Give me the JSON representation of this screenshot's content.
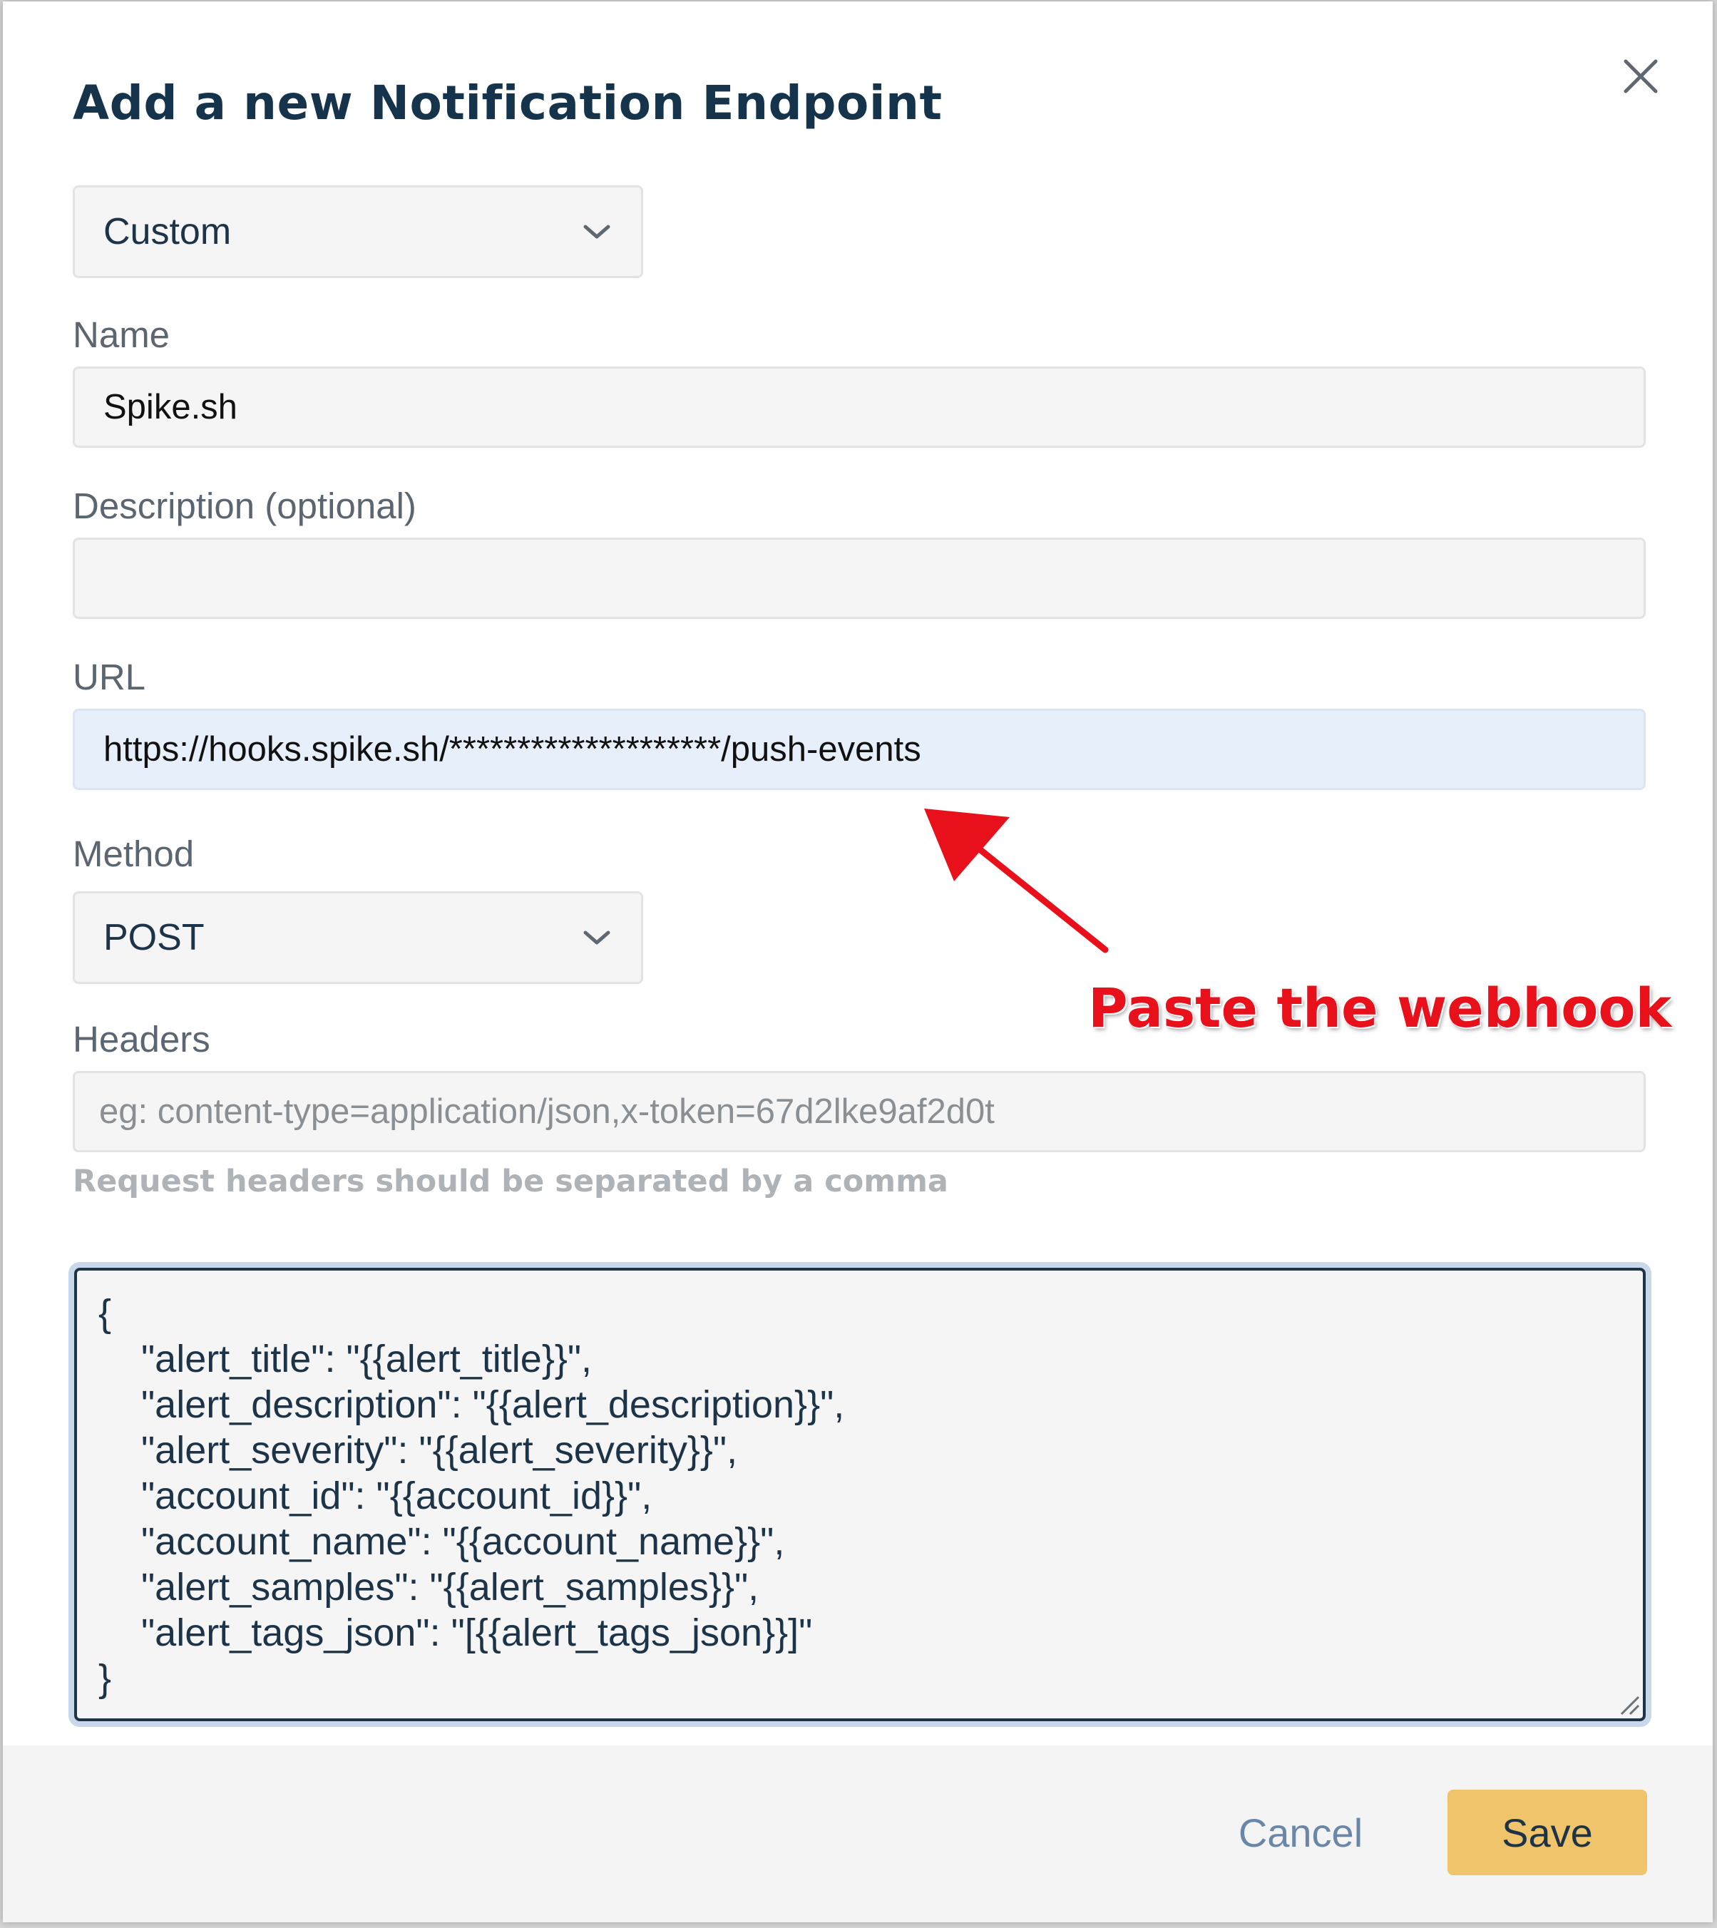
{
  "modal": {
    "title": "Add a new Notification Endpoint"
  },
  "type_select": {
    "value": "Custom"
  },
  "fields": {
    "name": {
      "label": "Name",
      "value": "Spike.sh"
    },
    "description": {
      "label": "Description (optional)",
      "value": ""
    },
    "url": {
      "label": "URL",
      "value": "https://hooks.spike.sh/********************/push-events"
    },
    "method": {
      "label": "Method",
      "value": "POST"
    },
    "headers": {
      "label": "Headers",
      "placeholder": "eg: content-type=application/json,x-token=67d2lke9af2d0t",
      "helper": "Request headers should be separated by a comma"
    },
    "body": {
      "value": "{\n    \"alert_title\": \"{{alert_title}}\",\n    \"alert_description\": \"{{alert_description}}\",\n    \"alert_severity\": \"{{alert_severity}}\",\n    \"account_id\": \"{{account_id}}\",\n    \"account_name\": \"{{account_name}}\",\n    \"alert_samples\": \"{{alert_samples}}\",\n    \"alert_tags_json\": \"[{{alert_tags_json}}]\"\n}"
    }
  },
  "footer": {
    "cancel_label": "Cancel",
    "save_label": "Save"
  },
  "annotation": {
    "text": "Paste the webhook"
  },
  "icons": {
    "close": "close-icon",
    "chevron": "chevron-down-icon",
    "resize": "resize-grip-icon",
    "arrow": "arrow-icon"
  },
  "colors": {
    "title": "#15334a",
    "save_button": "#f0c46b",
    "cancel_text": "#6a87a8",
    "annotation": "#e8111b",
    "url_field_bg": "#e7effb",
    "textarea_focus_ring": "#c9d7ea"
  }
}
